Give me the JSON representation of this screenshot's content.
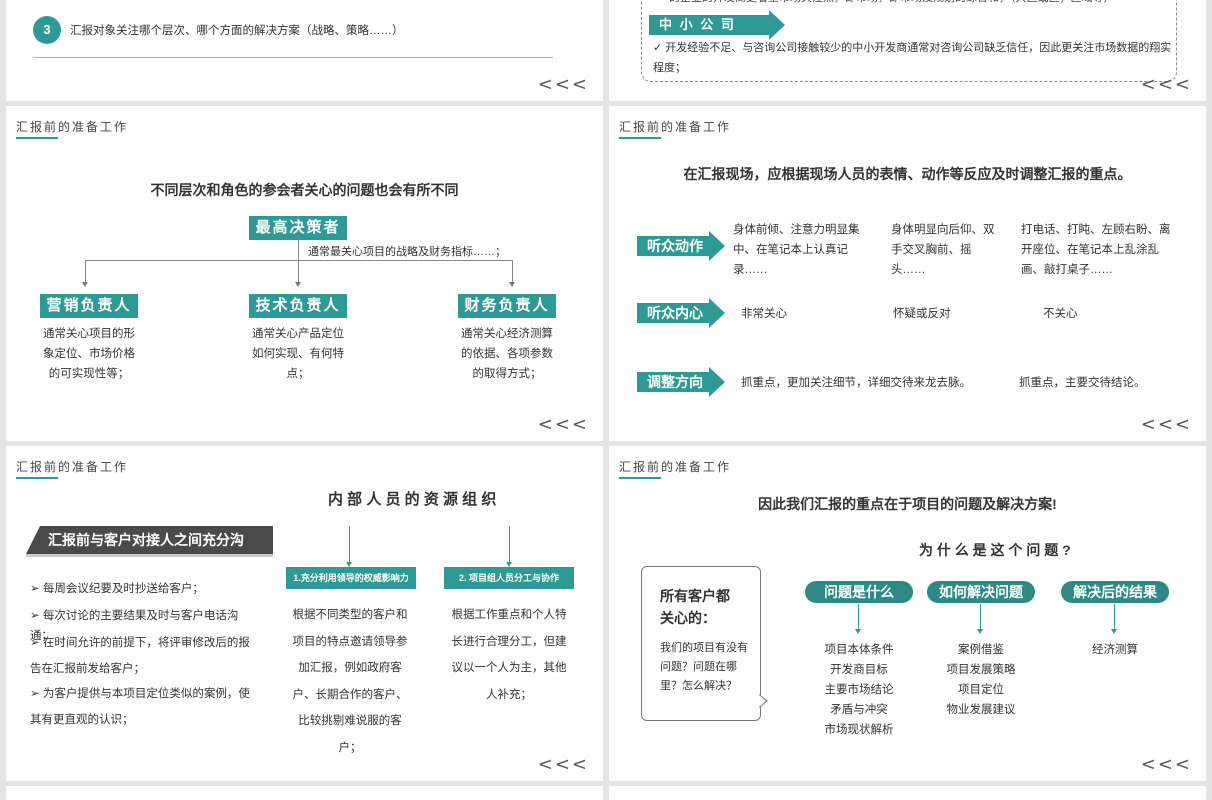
{
  "nav_label": "<<<",
  "section_title": "汇报前的准备工作",
  "p1": {
    "step_num": "3",
    "step_text": "汇报对象关注哪个层次、哪个方面的解决方案（战略、策略……）"
  },
  "p2": {
    "cut_text": "的企业的开发商更看重市场关注点，即市场，即市场及规划的综合和，（大区或区，区域等）",
    "tag": "中 小 公 司",
    "bullet": "✓ 开发经验不足、与咨询公司接触较少的中小开发商通常对咨询公司缺乏信任，因此更关注市场数据的翔实程度；"
  },
  "p3": {
    "headline": "不同层次和角色的参会者关心的问题也会有所不同",
    "top_role": "最高决策者",
    "top_desc": "通常最关心项目的战略及财务指标……；",
    "roles": [
      {
        "title": "营销负责人",
        "desc": "通常关心项目的形象定位、市场价格的可实现性等；"
      },
      {
        "title": "技术负责人",
        "desc": "通常关心产品定位如何实现、有何特点；"
      },
      {
        "title": "财务负责人",
        "desc": "通常关心经济测算的依据、各项参数的取得方式；"
      }
    ]
  },
  "p4": {
    "headline": "在汇报现场，应根据现场人员的表情、动作等反应及时调整汇报的重点。",
    "rows": [
      {
        "label": "听众动作",
        "cells": [
          "身体前倾、注意力明显集中、在笔记本上认真记录……",
          "身体明显向后仰、双手交叉胸前、摇头……",
          "打电话、打盹、左顾右盼、离开座位、在笔记本上乱涂乱画、敲打桌子……"
        ]
      },
      {
        "label": "听众内心",
        "cells": [
          "非常关心",
          "怀疑或反对",
          "不关心"
        ]
      },
      {
        "label": "调整方向",
        "cells": [
          "抓重点，更加关注细节，详细交待来龙去脉。",
          "抓重点，主要交待结论。"
        ]
      }
    ]
  },
  "p5": {
    "dark_title": "汇报前与客户对接人之间充分沟",
    "bullets": [
      "每周会议纪要及时抄送给客户；",
      "每次讨论的主要结果及时与客户电话沟通；",
      "在时间允许的前提下，将评审修改后的报告在汇报前发给客户；",
      "为客户提供与本项目定位类似的案例，使其有更直观的认识；"
    ],
    "headline": "内 部 人 员 的 资 源 组 织",
    "cols": [
      {
        "tag": "1.充分利用领导的权威影响力",
        "text": "根据不同类型的客户和项目的特点邀请领导参加汇报，例如政府客户、长期合作的客户、比较挑剔难说服的客户；"
      },
      {
        "tag": "2.  项目组人员分工与协作",
        "text": "根据工作重点和个人特长进行合理分工，但建议以一个人为主，其他人补充；"
      }
    ]
  },
  "p6": {
    "headline": "因此我们汇报的重点在于项目的问题及解决方案!",
    "sub": "为 什 么 是 这 个 问 题 ?",
    "bubble_title": "所有客户都关心的：",
    "bubble_text": "我们的项目有没有问题？问题在哪里？怎么解决？",
    "cols": [
      {
        "pill": "问题是什么",
        "items": [
          "项目本体条件",
          "开发商目标",
          "主要市场结论",
          "矛盾与冲突",
          "市场现状解析"
        ]
      },
      {
        "pill": "如何解决问题",
        "items": [
          "案例借鉴",
          "项目发展策略",
          "项目定位",
          "物业发展建议"
        ]
      },
      {
        "pill": "解决后的结果",
        "items": [
          "经济测算"
        ]
      }
    ]
  },
  "colors": {
    "teal": "#2e9a95",
    "dark": "#4a4a4a",
    "background": "#e4e4e4"
  }
}
